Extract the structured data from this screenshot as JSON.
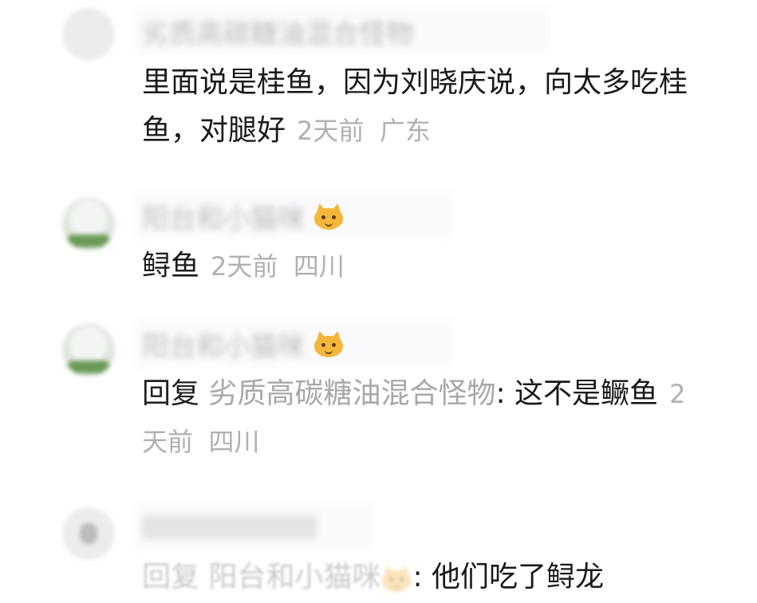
{
  "comments": [
    {
      "username": "劣质高碳糖油混合怪物",
      "text": "里面说是桂鱼，因为刘晓庆说，向太多吃桂鱼，对腿好",
      "time": "2天前",
      "location": "广东"
    },
    {
      "username": "阳台和小猫咪",
      "text": "鲟鱼",
      "time": "2天前",
      "location": "四川"
    },
    {
      "username": "阳台和小猫咪",
      "reply_prefix": "回复",
      "reply_target": "劣质高碳糖油混合怪物",
      "text": ": 这不是鳜鱼",
      "time": "2天前",
      "location": "四川"
    },
    {
      "reply_prefix": "回复",
      "reply_target": "阳台和小猫咪",
      "text": ": 他们吃了鲟龙"
    }
  ],
  "icons": {
    "cat_emoji": "cat-face-icon"
  }
}
